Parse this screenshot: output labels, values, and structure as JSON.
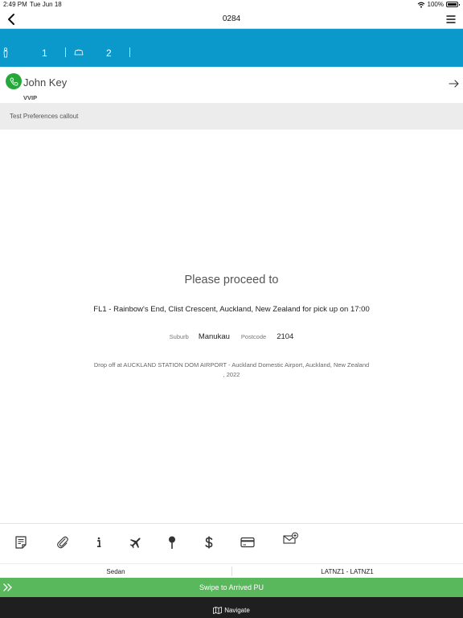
{
  "status_bar": {
    "time": "2:49 PM",
    "date": "Tue Jun 18",
    "battery": "100%"
  },
  "header": {
    "title": "0284"
  },
  "band": {
    "passengers_icon": "person-icon",
    "passengers": "1",
    "luggage_icon": "luggage-icon",
    "luggage": "2"
  },
  "passenger": {
    "name": "John Key",
    "tag": "VVIP"
  },
  "preferences": {
    "text": "Test Preferences callout"
  },
  "job": {
    "heading": "Please proceed to",
    "pickup": "FL1 - Rainbow's End, Clist Crescent, Auckland, New Zealand for pick up on 17:00",
    "suburb_label": "Suburb",
    "suburb": "Manukau",
    "postcode_label": "Postcode",
    "postcode": "2104",
    "dropoff_line1": "Drop off at AUCKLAND STATION DOM AIRPORT - Auckland Domestic Airport, Auckland, New Zealand",
    "dropoff_line2": ", 2022"
  },
  "toolbar": {
    "icons": [
      "notes-icon",
      "attachment-icon",
      "info-icon",
      "flight-icon",
      "location-pin-icon",
      "dollar-icon",
      "card-icon",
      "add-email-icon"
    ]
  },
  "vehicle": {
    "type": "Sedan",
    "code": "LATNZ1 - LATNZ1"
  },
  "actions": {
    "swipe": "Swipe to Arrived PU",
    "navigate": "Navigate"
  },
  "colors": {
    "band": "#0b99cc",
    "phone": "#25a83a",
    "swipe": "#5ab85c",
    "navigate": "#1f1f1f"
  }
}
